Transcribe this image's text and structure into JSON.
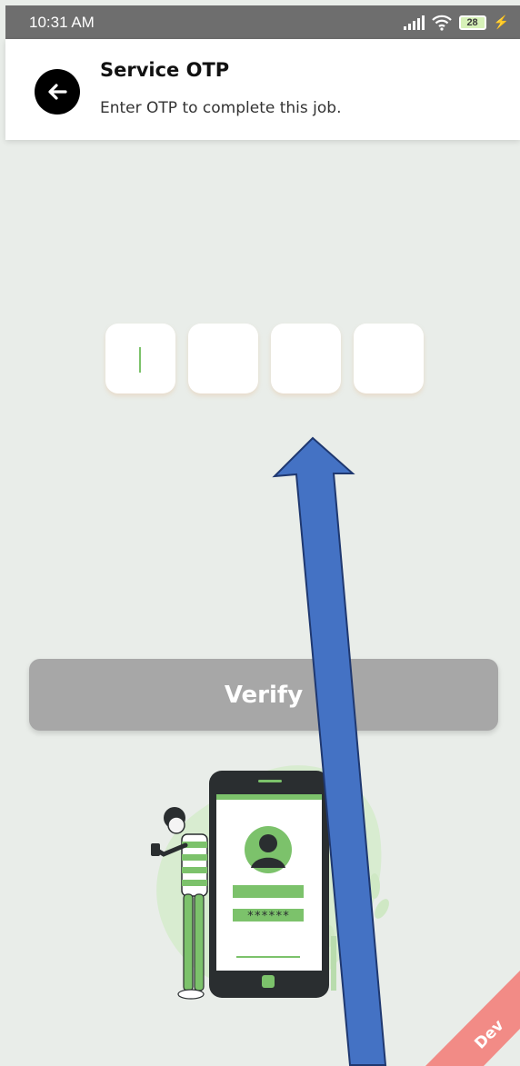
{
  "status_bar": {
    "time": "10:31 AM",
    "battery": "28",
    "icons": [
      "signal-icon",
      "wifi-icon",
      "battery-icon",
      "charging-icon"
    ]
  },
  "header": {
    "title": "Service OTP",
    "subtitle": "Enter OTP to complete this job.",
    "back_icon": "arrow-left-icon"
  },
  "otp": {
    "digits": [
      "",
      "",
      "",
      ""
    ]
  },
  "verify": {
    "label": "Verify"
  },
  "illustration": {
    "masked_password": "******"
  },
  "badge": {
    "label": "Dev",
    "color": "#f28b86"
  },
  "colors": {
    "accent": "#7cc26b",
    "background": "#e9ede9",
    "button_disabled": "#a7a7a7",
    "overlay_arrow": "#4472c4"
  }
}
